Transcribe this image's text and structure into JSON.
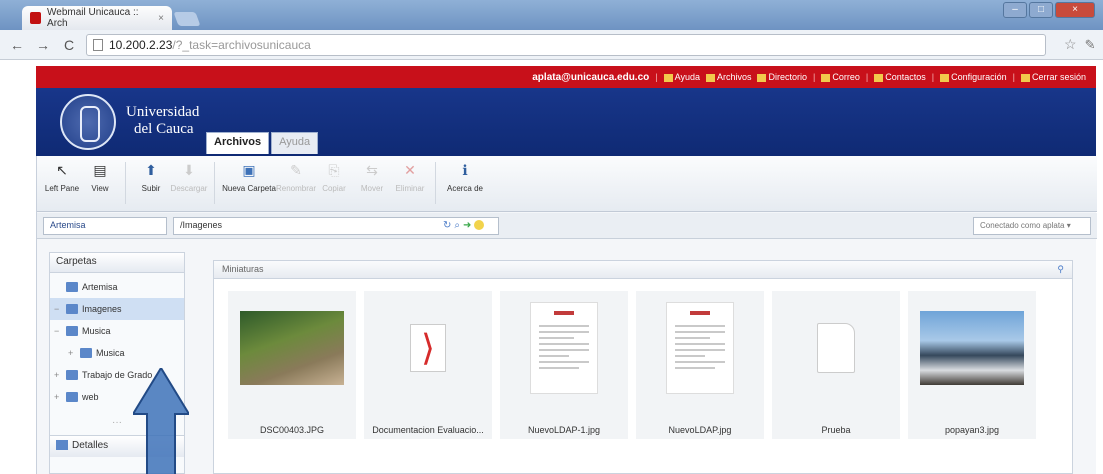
{
  "browser": {
    "tab_title": "Webmail Unicauca :: Arch",
    "tab_close": "×",
    "url_host": "10.200.2.23",
    "url_path": "/?_task=archivosunicauca",
    "back": "←",
    "forward": "→",
    "reload": "C",
    "star": "☆",
    "wrench": "✎",
    "minimize": "–",
    "maximize": "□",
    "close": "×"
  },
  "topbar": {
    "email": "aplata@unicauca.edu.co",
    "links": [
      "Ayuda",
      "Archivos",
      "Directorio",
      "Correo",
      "Contactos",
      "Configuración",
      "Cerrar sesión"
    ],
    "sep": "|"
  },
  "banner": {
    "university_line1": "Universidad",
    "university_line2": "del Cauca",
    "tabs": [
      "Archivos",
      "Ayuda"
    ]
  },
  "toolbar": {
    "buttons": [
      {
        "label": "Left Pane",
        "icon": "↖",
        "enabled": true
      },
      {
        "label": "View",
        "icon": "▤",
        "enabled": true
      },
      {
        "label": "Subir",
        "icon": "⬆",
        "enabled": true
      },
      {
        "label": "Descargar",
        "icon": "⬇",
        "enabled": false
      },
      {
        "label": "Nueva Carpeta",
        "icon": "▣",
        "enabled": true
      },
      {
        "label": "Renombrar",
        "icon": "✎",
        "enabled": false
      },
      {
        "label": "Copiar",
        "icon": "⎘",
        "enabled": false
      },
      {
        "label": "Mover",
        "icon": "⇆",
        "enabled": false
      },
      {
        "label": "Eliminar",
        "icon": "✕",
        "enabled": false
      },
      {
        "label": "Acerca de",
        "icon": "ℹ",
        "enabled": true
      }
    ]
  },
  "pathbar": {
    "location": "Artemisa",
    "path": "/Imagenes",
    "connected": "Conectado como aplata ▾"
  },
  "left_pane": {
    "folders_header": "Carpetas",
    "details_header": "Detalles",
    "collapse": "···",
    "tree": [
      {
        "label": "Artemisa",
        "level": 0,
        "pm": "",
        "selected": false
      },
      {
        "label": "Imagenes",
        "level": 0,
        "pm": "−",
        "selected": true
      },
      {
        "label": "Musica",
        "level": 0,
        "pm": "−",
        "selected": false
      },
      {
        "label": "Musica",
        "level": 1,
        "pm": "+",
        "selected": false
      },
      {
        "label": "Trabajo de Grado",
        "level": 0,
        "pm": "+",
        "selected": false
      },
      {
        "label": "web",
        "level": 0,
        "pm": "+",
        "selected": false
      }
    ]
  },
  "main": {
    "header": "Miniaturas",
    "search_icon": "🔍",
    "files": [
      {
        "name": "DSC00403.JPG",
        "kind": "photo1"
      },
      {
        "name": "Documentacion Evaluacio...",
        "kind": "pdf"
      },
      {
        "name": "NuevoLDAP-1.jpg",
        "kind": "doc"
      },
      {
        "name": "NuevoLDAP.jpg",
        "kind": "doc"
      },
      {
        "name": "Prueba",
        "kind": "blank"
      },
      {
        "name": "popayan3.jpg",
        "kind": "photo2"
      }
    ]
  },
  "colors": {
    "red_bar": "#c8101a",
    "banner_blue": "#18368a",
    "arrow": "#3e72b8"
  }
}
